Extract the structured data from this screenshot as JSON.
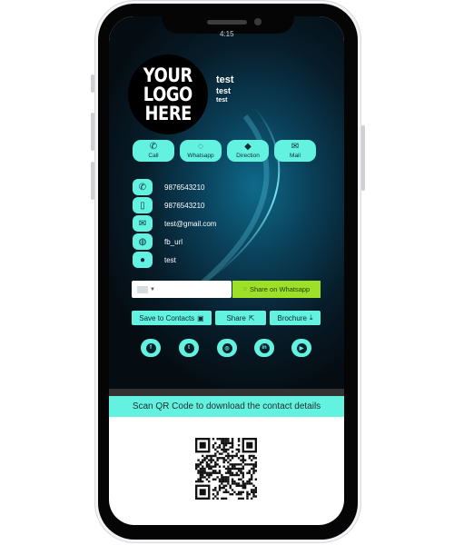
{
  "statusbar": {
    "time": "4:15"
  },
  "logo": {
    "line1": "YOUR",
    "line2": "LOGO",
    "line3": "HERE"
  },
  "profile": {
    "name": "test",
    "designation": "test",
    "company": "test"
  },
  "actions": [
    {
      "label": "Call",
      "icon": "phone-icon"
    },
    {
      "label": "Whatsapp",
      "icon": "whatsapp-icon"
    },
    {
      "label": "Direction",
      "icon": "direction-icon"
    },
    {
      "label": "Mail",
      "icon": "mail-icon"
    }
  ],
  "contacts": [
    {
      "icon": "phone-icon",
      "text": "9876543210"
    },
    {
      "icon": "mobile-icon",
      "text": "9876543210"
    },
    {
      "icon": "envelope-icon",
      "text": "test@gmail.com"
    },
    {
      "icon": "globe-icon",
      "text": "fb_url"
    },
    {
      "icon": "location-pin-icon",
      "text": "test"
    }
  ],
  "share": {
    "phone_value": "",
    "whatsapp_label": "Share on Whatsapp"
  },
  "buttons": {
    "save_label": "Save to Contacts",
    "share_label": "Share",
    "brochure_label": "Brochure"
  },
  "social": [
    {
      "name": "facebook",
      "icon": "facebook-icon",
      "glyph": "f"
    },
    {
      "name": "twitter",
      "icon": "twitter-icon",
      "glyph": "t"
    },
    {
      "name": "instagram",
      "icon": "instagram-icon",
      "glyph": "◎"
    },
    {
      "name": "linkedin",
      "icon": "linkedin-icon",
      "glyph": "in"
    },
    {
      "name": "youtube",
      "icon": "youtube-icon",
      "glyph": "▶"
    }
  ],
  "qr": {
    "caption": "Scan QR Code to download the contact details"
  },
  "colors": {
    "accent": "#64f2e0",
    "whatsapp": "#9ee028",
    "card_dark": "#071c29"
  }
}
